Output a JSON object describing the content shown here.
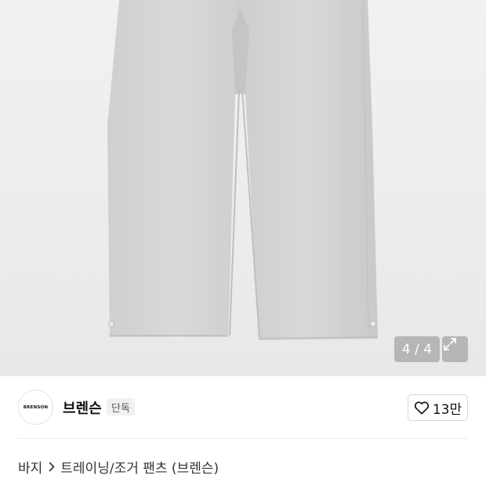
{
  "gallery": {
    "counter_text": "4 / 4",
    "current_index": 4,
    "total": 4
  },
  "brand": {
    "logo_text": "BRENSON",
    "name": "브렌슨",
    "badge": "단독"
  },
  "like": {
    "count": "13만",
    "icon": "heart-outline-icon"
  },
  "breadcrumb": {
    "category": "바지",
    "separator_icon": "chevron-right-icon",
    "subcategory": "트레이닝/조거 팬츠 (브렌슨)"
  },
  "colors": {
    "image_background": "#ececed",
    "pants_gray": "#d4d4d6",
    "overlay": "#787878",
    "badge_bg": "#f1f1f1"
  }
}
